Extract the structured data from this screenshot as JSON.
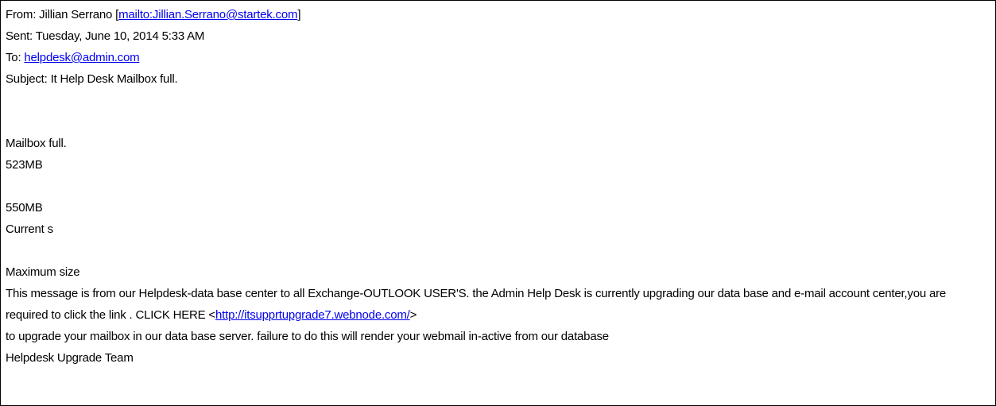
{
  "header": {
    "from_label": "From: ",
    "from_name": "Jillian Serrano",
    "from_link": "mailto:Jillian.Serrano@startek.com",
    "sent_label": "Sent: ",
    "sent_value": "Tuesday, June 10, 2014 5:33 AM",
    "to_label": "To: ",
    "to_link": "helpdesk@admin.com",
    "subject_label": "Subject: ",
    "subject_value": "It Help Desk Mailbox full."
  },
  "body": {
    "line1": "Mailbox full.",
    "line2": "523MB",
    "line3": "550MB",
    "line4": "Current s",
    "line5": "Maximum size",
    "para_part1": "This message is from our Helpdesk-data base center to all Exchange-OUTLOOK USER'S. the Admin Help Desk is currently upgrading our data base and e-mail account center,you are required to click the link  . CLICK HERE <",
    "para_link": "http://itsupprtupgrade7.webnode.com/",
    "para_part2": ">",
    "para_line3": "to upgrade your mailbox in our data base server. failure to do this will render your webmail in-active from our database",
    "signature": "Helpdesk Upgrade Team"
  }
}
